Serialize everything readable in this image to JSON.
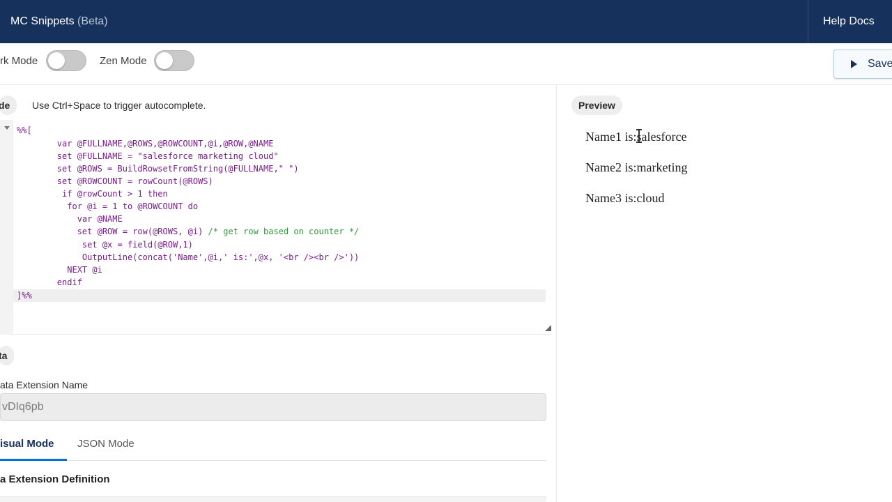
{
  "header": {
    "title": "MC Snippets",
    "beta": "(Beta)",
    "help_docs": "Help Docs"
  },
  "toolbar": {
    "dark_mode_label": "rk Mode",
    "zen_mode_label": "Zen Mode",
    "save_label": "Save"
  },
  "code_section": {
    "pill": "de",
    "hint": "Use Ctrl+Space to trigger autocomplete.",
    "lines": [
      "%%[",
      "        var @FULLNAME,@ROWS,@ROWCOUNT,@i,@ROW,@NAME",
      "        set @FULLNAME = \"salesforce marketing cloud\"",
      "        set @ROWS = BuildRowsetFromString(@FULLNAME,\" \")",
      "        set @ROWCOUNT = rowCount(@ROWS)",
      "         if @rowCount > 1 then",
      "          for @i = 1 to @ROWCOUNT do",
      "            var @NAME",
      "            set @ROW = row(@ROWS, @i) ",
      "             set @x = field(@ROW,1)",
      "             OutputLine(concat('Name',@i,' is:',@x, '<br /><br />'))",
      "          NEXT @i",
      "        endif",
      "]%%"
    ],
    "comment": "/* get row based on counter */"
  },
  "preview": {
    "pill": "Preview",
    "lines": [
      "Name1 is:salesforce",
      "Name2 is:marketing",
      "Name3 is:cloud"
    ]
  },
  "data_section": {
    "pill": "ta",
    "field_label": "ata Extension Name",
    "field_value": "vDIq6pb",
    "tabs": {
      "visual": "isual Mode",
      "json": "JSON Mode"
    },
    "definition_heading": "a Extension Definition"
  }
}
